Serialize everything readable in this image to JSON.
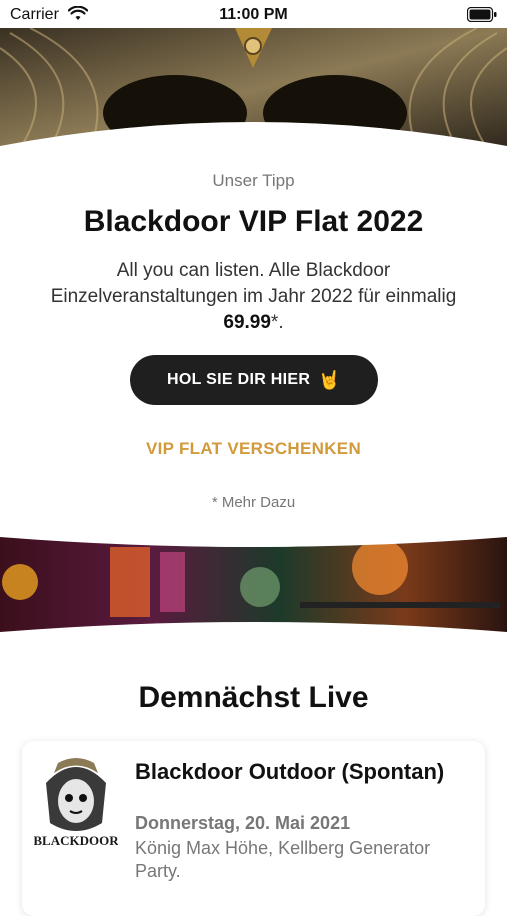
{
  "status_bar": {
    "carrier": "Carrier",
    "time": "11:00 PM"
  },
  "promo": {
    "eyebrow": "Unser Tipp",
    "title": "Blackdoor VIP Flat 2022",
    "description": "All you can listen. Alle Blackdoor Einzelveranstaltungen im Jahr 2022 für einmalig",
    "price": "69.99",
    "price_suffix": "*.",
    "cta_label": "HOL SIE DIR HIER",
    "cta_emoji": "🤘",
    "gift_label": "VIP FLAT VERSCHENKEN",
    "more_label": "* Mehr Dazu"
  },
  "upcoming": {
    "section_title": "Demnächst Live",
    "events": [
      {
        "title": "Blackdoor Outdoor (Spontan)",
        "date": "Donnerstag, 20. Mai 2021",
        "venue": "König Max Höhe, Kellberg Generator Party.",
        "logo_text": "BLACKDOOR"
      }
    ]
  },
  "colors": {
    "accent_gold": "#d19a3a",
    "button_dark": "#1f1f1f"
  }
}
